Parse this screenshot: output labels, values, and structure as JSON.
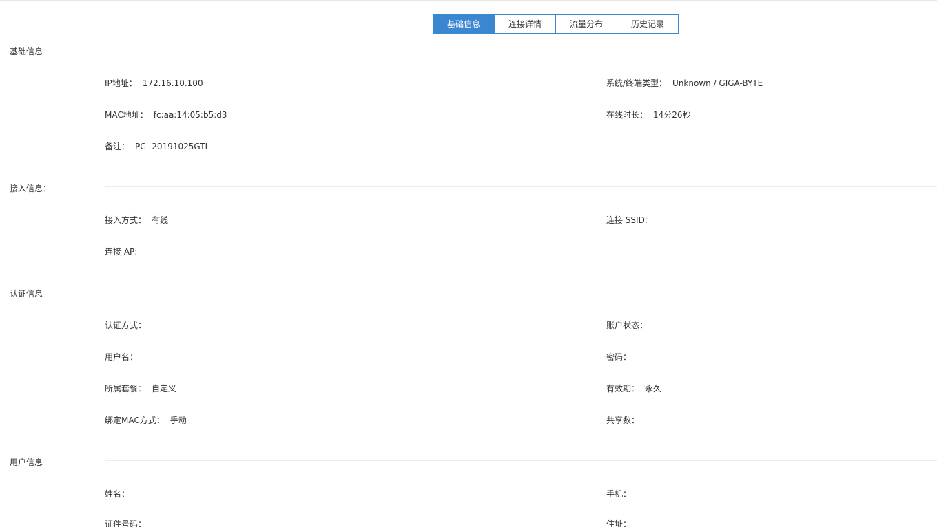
{
  "tabs": [
    {
      "label": "基础信息",
      "active": true
    },
    {
      "label": "连接详情",
      "active": false
    },
    {
      "label": "流量分布",
      "active": false
    },
    {
      "label": "历史记录",
      "active": false
    }
  ],
  "colors": {
    "accent": "#3a86d0",
    "divider": "#ececec",
    "text": "#333333"
  },
  "sections": {
    "basic": {
      "title": "基础信息",
      "ip_label": "IP地址：",
      "ip_value": "172.16.10.100",
      "os_label": "系统/终端类型：",
      "os_value": "Unknown / GIGA-BYTE",
      "mac_label": "MAC地址：",
      "mac_value": "fc:aa:14:05:b5:d3",
      "online_label": "在线时长：",
      "online_value": "14分26秒",
      "note_label": "备注：",
      "note_value": "PC--20191025GTL"
    },
    "access": {
      "title": "接入信息：",
      "mode_label": "接入方式：",
      "mode_value": "有线",
      "ssid_label": "连接 SSID:",
      "ssid_value": "",
      "ap_label": "连接 AP:",
      "ap_value": ""
    },
    "auth": {
      "title": "认证信息",
      "method_label": "认证方式：",
      "method_value": "",
      "account_status_label": "账户状态：",
      "account_status_value": "",
      "username_label": "用户名：",
      "username_value": "",
      "password_label": "密码：",
      "password_value": "",
      "package_label": "所属套餐：",
      "package_value": "自定义",
      "validity_label": "有效期：",
      "validity_value": "永久",
      "bind_mac_label": "绑定MAC方式：",
      "bind_mac_value": "手动",
      "share_label": "共享数：",
      "share_value": ""
    },
    "user": {
      "title": "用户信息",
      "name_label": "姓名：",
      "name_value": "",
      "phone_label": "手机：",
      "phone_value": "",
      "id_label": "证件号码：",
      "id_value": "",
      "address_label": "住址：",
      "address_value": ""
    }
  }
}
